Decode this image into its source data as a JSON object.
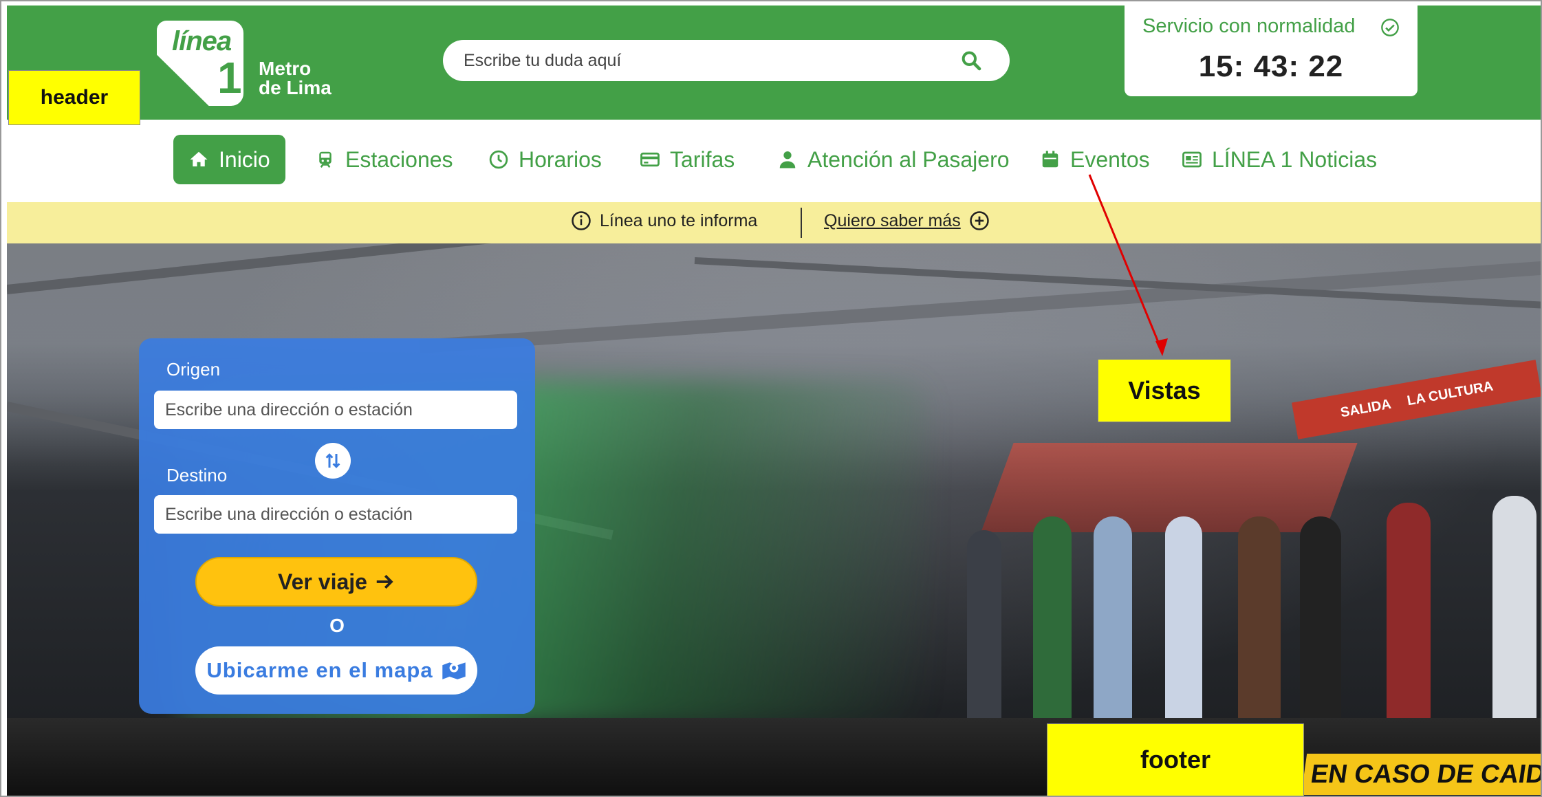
{
  "header": {
    "logo": {
      "word": "línea",
      "number": "1",
      "sub_line1": "Metro",
      "sub_line2": "de Lima"
    },
    "search": {
      "placeholder": "Escribe tu duda aquí",
      "icon": "search-icon"
    },
    "status": {
      "text": "Servicio con normalidad",
      "icon": "check-circle-icon",
      "clock": "15: 43: 22"
    }
  },
  "nav": {
    "items": [
      {
        "label": "Inicio",
        "icon": "home-icon",
        "active": true
      },
      {
        "label": "Estaciones",
        "icon": "train-icon"
      },
      {
        "label": "Horarios",
        "icon": "clock-icon"
      },
      {
        "label": "Tarifas",
        "icon": "card-icon"
      },
      {
        "label": "Atención al Pasajero",
        "icon": "user-icon"
      },
      {
        "label": "Eventos",
        "icon": "calendar-icon"
      },
      {
        "label": "LÍNEA 1 Noticias",
        "icon": "newspaper-icon"
      }
    ]
  },
  "infobar": {
    "info_text": "Línea uno te informa",
    "link_text": "Quiero saber más"
  },
  "trip": {
    "origin_label": "Origen",
    "origin_placeholder": "Escribe una dirección o estación",
    "destination_label": "Destino",
    "destination_placeholder": "Escribe una dirección o estación",
    "view_trip": "Ver viaje",
    "or_text": "O",
    "locate_map": "Ubicarme en el mapa"
  },
  "hero": {
    "sign_left": "SALIDA",
    "sign_right": "LA CULTURA",
    "caution": "EN CASO DE CAID"
  },
  "annotations": {
    "header": "header",
    "vistas": "Vistas",
    "footer": "footer"
  },
  "colors": {
    "brand_green": "#43a047",
    "trip_blue": "#3a7ce0",
    "cta_yellow": "#ffc20e",
    "info_yellow": "#f7ee9b"
  }
}
